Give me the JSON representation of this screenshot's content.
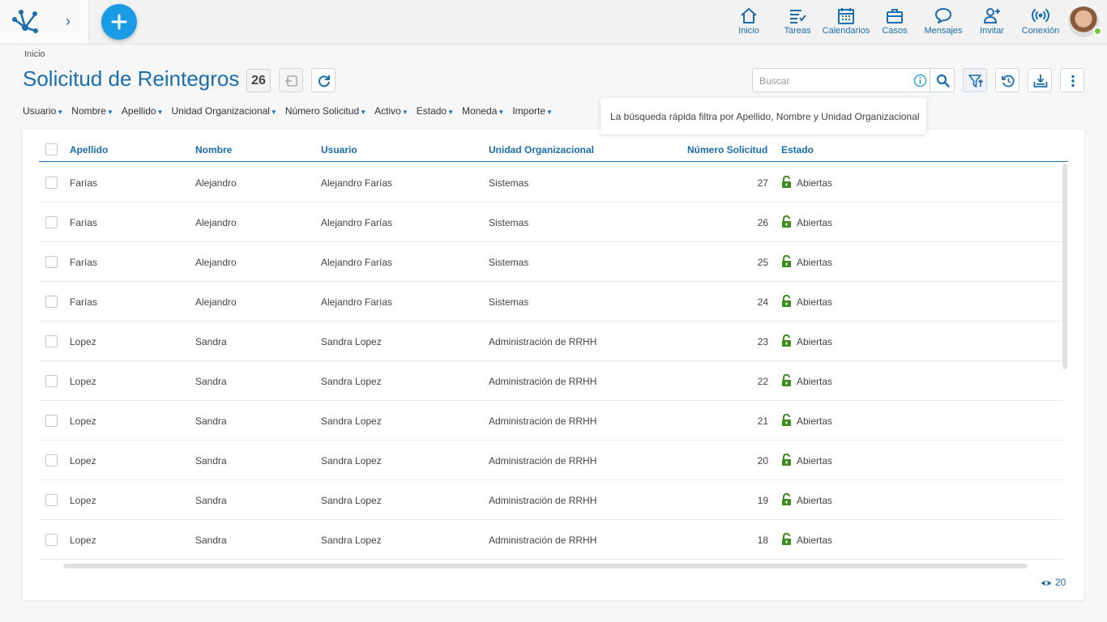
{
  "nav": {
    "items": [
      {
        "label": "Inicio",
        "icon": "home-icon"
      },
      {
        "label": "Tareas",
        "icon": "tasks-icon"
      },
      {
        "label": "Calendarios",
        "icon": "calendar-icon"
      },
      {
        "label": "Casos",
        "icon": "briefcase-icon"
      },
      {
        "label": "Mensajes",
        "icon": "chat-icon"
      },
      {
        "label": "Invitar",
        "icon": "add-user-icon"
      },
      {
        "label": "Conexión",
        "icon": "broadcast-icon"
      }
    ]
  },
  "breadcrumb": "Inicio",
  "page": {
    "title": "Solicitud de Reintegros",
    "count": "26"
  },
  "search": {
    "placeholder": "Buscar",
    "tooltip": "La búsqueda rápida filtra por Apellido, Nombre y Unidad Organizacional"
  },
  "filters": [
    "Usuario",
    "Nombre",
    "Apellido",
    "Unidad Organizacional",
    "Número Solicitud",
    "Activo",
    "Estado",
    "Moneda",
    "Importe"
  ],
  "table": {
    "columns": [
      "Apellido",
      "Nombre",
      "Usuario",
      "Unidad Organizacional",
      "Número Solicitud",
      "Estado"
    ],
    "rows": [
      [
        "Farías",
        "Alejandro",
        "Alejandro Farías",
        "Sistemas",
        "27",
        "Abiertas"
      ],
      [
        "Farías",
        "Alejandro",
        "Alejandro Farías",
        "Sistemas",
        "26",
        "Abiertas"
      ],
      [
        "Farías",
        "Alejandro",
        "Alejandro Farías",
        "Sistemas",
        "25",
        "Abiertas"
      ],
      [
        "Farías",
        "Alejandro",
        "Alejandro Farías",
        "Sistemas",
        "24",
        "Abiertas"
      ],
      [
        "Lopez",
        "Sandra",
        "Sandra Lopez",
        "Administración de RRHH",
        "23",
        "Abiertas"
      ],
      [
        "Lopez",
        "Sandra",
        "Sandra Lopez",
        "Administración de RRHH",
        "22",
        "Abiertas"
      ],
      [
        "Lopez",
        "Sandra",
        "Sandra Lopez",
        "Administración de RRHH",
        "21",
        "Abiertas"
      ],
      [
        "Lopez",
        "Sandra",
        "Sandra Lopez",
        "Administración de RRHH",
        "20",
        "Abiertas"
      ],
      [
        "Lopez",
        "Sandra",
        "Sandra Lopez",
        "Administración de RRHH",
        "19",
        "Abiertas"
      ],
      [
        "Lopez",
        "Sandra",
        "Sandra Lopez",
        "Administración de RRHH",
        "18",
        "Abiertas"
      ]
    ]
  },
  "footer": {
    "page_size": "20"
  },
  "colors": {
    "accent": "#1a6eb0",
    "add_button": "#1a9be6",
    "status_open": "#3d8c1f",
    "online": "#7ac943"
  }
}
